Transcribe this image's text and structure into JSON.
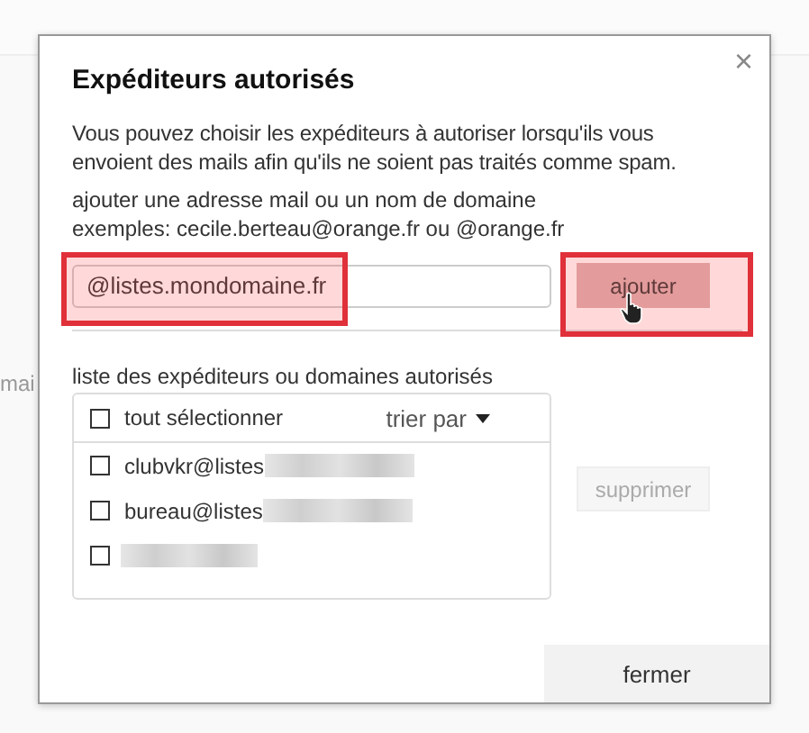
{
  "background_text": "mai",
  "dialog": {
    "title": "Expéditeurs autorisés",
    "close": "×",
    "intro": "Vous pouvez choisir les expéditeurs à autoriser lorsqu'ils vous envoient des mails afin qu'ils ne soient pas traités comme spam.",
    "add_hint": "ajouter une adresse mail ou un nom de domaine",
    "examples": "exemples: cecile.berteau@orange.fr ou @orange.fr",
    "input": {
      "value": "@listes.mondomaine.fr",
      "highlighted": true
    },
    "add_button": {
      "label": "ajouter",
      "highlighted": true
    },
    "list_label": "liste des expéditeurs ou domaines autorisés",
    "select_all": {
      "label": "tout sélectionner",
      "checked": false
    },
    "sort": "trier par",
    "rows": [
      {
        "kind": "partial",
        "text": "clubvkr@listes",
        "checked": false
      },
      {
        "kind": "partial",
        "text": "bureau@listes",
        "checked": false
      },
      {
        "kind": "hidden",
        "checked": false
      }
    ],
    "delete_button": {
      "label": "supprimer",
      "disabled": true
    },
    "close_button": "fermer"
  }
}
